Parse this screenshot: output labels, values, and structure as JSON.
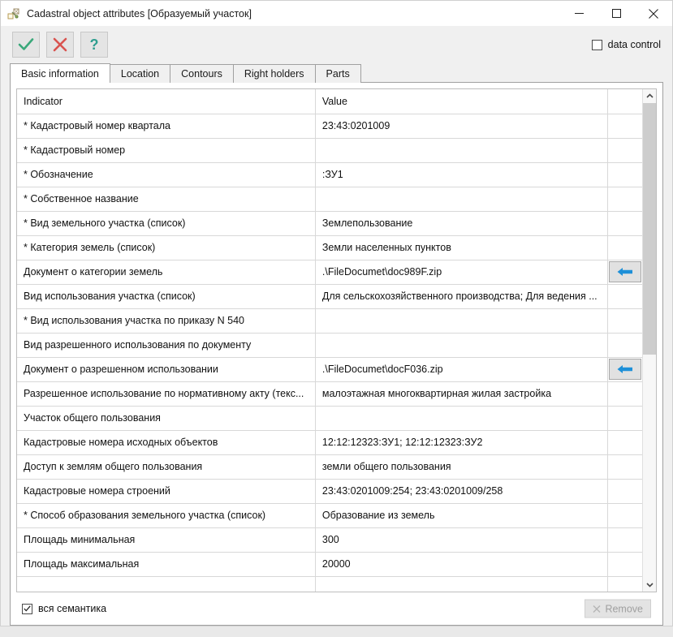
{
  "window": {
    "title": "Cadastral object attributes [Образуемый участок]",
    "app_icon": "cadastral-plot-icon",
    "controls": {
      "minimize": "minimize-icon",
      "maximize": "maximize-icon",
      "close": "close-icon"
    }
  },
  "toolbar": {
    "buttons": [
      {
        "name": "ok-button",
        "icon": "check-icon",
        "color": "#3aa87a"
      },
      {
        "name": "cancel-button",
        "icon": "cross-icon",
        "color": "#d9534f"
      },
      {
        "name": "help-button",
        "icon": "question-icon",
        "color": "#2f9e8f"
      }
    ],
    "data_control": {
      "label": "data control",
      "checked": false
    }
  },
  "tabs": [
    {
      "label": "Basic information",
      "active": true
    },
    {
      "label": "Location",
      "active": false
    },
    {
      "label": "Contours",
      "active": false
    },
    {
      "label": "Right holders",
      "active": false
    },
    {
      "label": "Parts",
      "active": false
    }
  ],
  "grid": {
    "columns": [
      "Indicator",
      "Value",
      ""
    ],
    "rows": [
      {
        "indicator": "* Кадастровый номер квартала",
        "value": "23:43:0201009",
        "button": false
      },
      {
        "indicator": "* Кадастровый номер",
        "value": "",
        "button": false
      },
      {
        "indicator": "* Обозначение",
        "value": ":ЗУ1",
        "button": false
      },
      {
        "indicator": "* Собственное название",
        "value": "",
        "button": false
      },
      {
        "indicator": "* Вид земельного участка (список)",
        "value": "Землепользование",
        "button": false
      },
      {
        "indicator": "* Категория земель (список)",
        "value": "Земли населенных пунктов",
        "button": false
      },
      {
        "indicator": "Документ о категории земель",
        "value": ".\\FileDocumet\\doc989F.zip",
        "button": true
      },
      {
        "indicator": "Вид использования участка (список)",
        "value": "Для сельскохозяйственного производства; Для ведения ...",
        "button": false
      },
      {
        "indicator": "* Вид использования участка по приказу N 540",
        "value": "",
        "button": false
      },
      {
        "indicator": "Вид разрешенного использования по документу",
        "value": "",
        "button": false
      },
      {
        "indicator": "Документ о разрешенном использовании",
        "value": ".\\FileDocumet\\docF036.zip",
        "button": true
      },
      {
        "indicator": "Разрешенное использование по нормативному акту (текс...",
        "value": "малоэтажная многоквартирная жилая застройка",
        "button": false
      },
      {
        "indicator": "Участок общего пользования",
        "value": "",
        "button": false
      },
      {
        "indicator": "Кадастровые номера исходных объектов",
        "value": "12:12:12323:ЗУ1; 12:12:12323:ЗУ2",
        "button": false
      },
      {
        "indicator": "Доступ к землям общего пользования",
        "value": "земли общего пользования",
        "button": false
      },
      {
        "indicator": "Кадастровые номера строений",
        "value": "23:43:0201009:254; 23:43:0201009/258",
        "button": false
      },
      {
        "indicator": "* Способ образования земельного участка (список)",
        "value": "Образование из земель",
        "button": false
      },
      {
        "indicator": "Площадь минимальная",
        "value": "300",
        "button": false
      },
      {
        "indicator": "Площадь максимальная",
        "value": "20000",
        "button": false
      },
      {
        "indicator": "",
        "value": "",
        "button": false
      }
    ],
    "cell_button_icon": "arrow-left-icon",
    "scrollbar": {
      "up_icon": "chevron-up-icon",
      "down_icon": "chevron-down-icon",
      "thumb_position": "top"
    }
  },
  "footer": {
    "semantics_checkbox": {
      "label": "вся семантика",
      "checked": true
    },
    "remove_button": {
      "label": "Remove",
      "icon": "cross-icon",
      "disabled": true
    }
  },
  "colors": {
    "accent_blue": "#1e90d8",
    "ok_green": "#3aa87a",
    "cancel_red": "#d9534f",
    "help_teal": "#2f9e8f"
  }
}
